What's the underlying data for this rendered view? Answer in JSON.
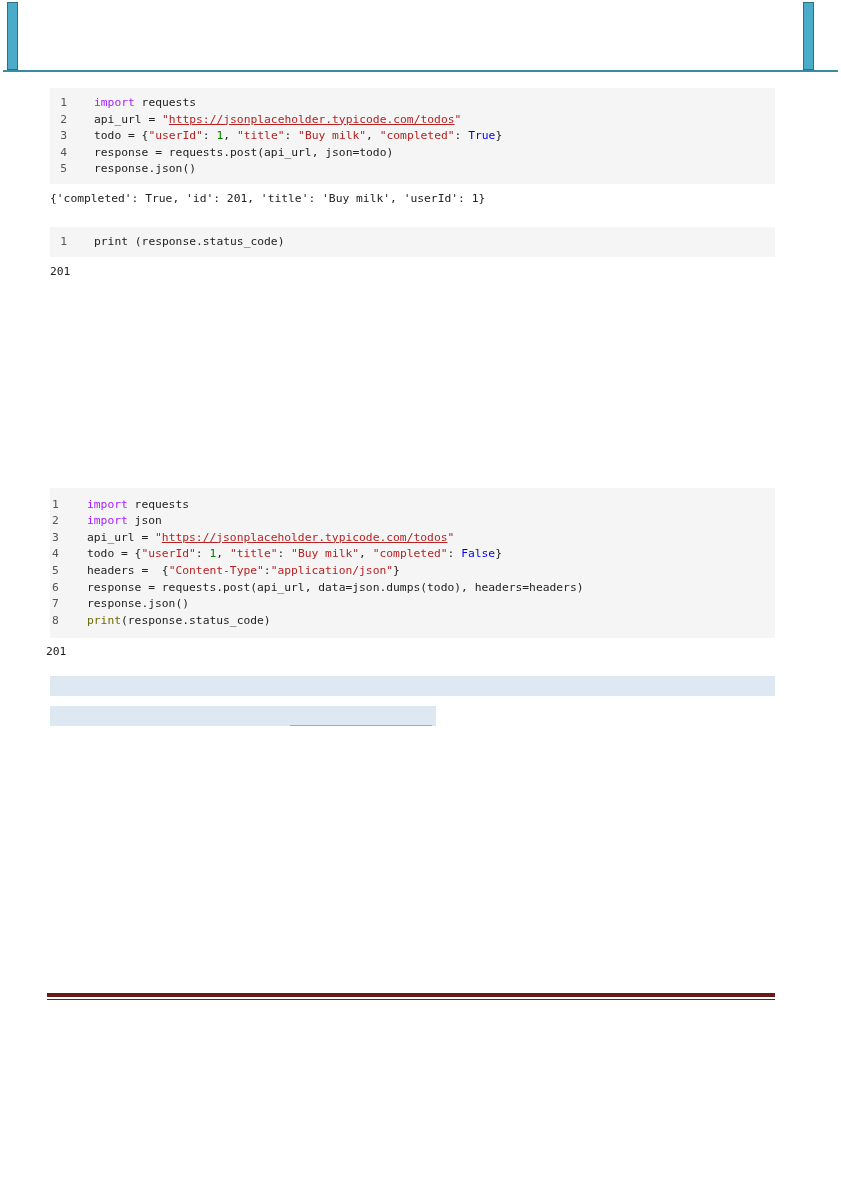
{
  "cells": [
    {
      "kind": "code",
      "lines": [
        {
          "number": "1",
          "tokens": [
            {
              "kind": "keyword",
              "text": "import"
            },
            {
              "kind": "plain",
              "text": " requests"
            }
          ]
        },
        {
          "number": "2",
          "tokens": [
            {
              "kind": "plain",
              "text": "api_url = "
            },
            {
              "kind": "string",
              "text": "\""
            },
            {
              "kind": "link",
              "text": "https://jsonplaceholder.typicode.com/todos"
            },
            {
              "kind": "string",
              "text": "\""
            }
          ]
        },
        {
          "number": "3",
          "tokens": [
            {
              "kind": "plain",
              "text": "todo = {"
            },
            {
              "kind": "string",
              "text": "\"userId\""
            },
            {
              "kind": "plain",
              "text": ": "
            },
            {
              "kind": "number",
              "text": "1"
            },
            {
              "kind": "plain",
              "text": ", "
            },
            {
              "kind": "string",
              "text": "\"title\""
            },
            {
              "kind": "plain",
              "text": ": "
            },
            {
              "kind": "string",
              "text": "\"Buy milk\""
            },
            {
              "kind": "plain",
              "text": ", "
            },
            {
              "kind": "string",
              "text": "\"completed\""
            },
            {
              "kind": "plain",
              "text": ": "
            },
            {
              "kind": "constant",
              "text": "True"
            },
            {
              "kind": "plain",
              "text": "}"
            }
          ]
        },
        {
          "number": "4",
          "tokens": [
            {
              "kind": "plain",
              "text": "response = requests.post(api_url, json=todo)"
            }
          ]
        },
        {
          "number": "5",
          "tokens": [
            {
              "kind": "plain",
              "text": "response.json()"
            }
          ]
        }
      ]
    },
    {
      "kind": "output",
      "text": "{'completed': True, 'id': 201, 'title': 'Buy milk', 'userId': 1}"
    },
    {
      "kind": "code",
      "lines": [
        {
          "number": "1",
          "tokens": [
            {
              "kind": "plain",
              "text": "print (response.status_code)"
            }
          ]
        }
      ]
    },
    {
      "kind": "output",
      "text": "201"
    },
    {
      "kind": "gap"
    },
    {
      "kind": "code_wide",
      "lines": [
        {
          "number": "1",
          "tokens": [
            {
              "kind": "keyword",
              "text": "import"
            },
            {
              "kind": "plain",
              "text": " requests"
            }
          ]
        },
        {
          "number": "2",
          "tokens": [
            {
              "kind": "keyword",
              "text": "import"
            },
            {
              "kind": "plain",
              "text": " json"
            }
          ]
        },
        {
          "number": "3",
          "tokens": [
            {
              "kind": "plain",
              "text": "api_url = "
            },
            {
              "kind": "string",
              "text": "\""
            },
            {
              "kind": "link",
              "text": "https://jsonplaceholder.typicode.com/todos"
            },
            {
              "kind": "string",
              "text": "\""
            }
          ]
        },
        {
          "number": "4",
          "tokens": [
            {
              "kind": "plain",
              "text": "todo = {"
            },
            {
              "kind": "string",
              "text": "\"userId\""
            },
            {
              "kind": "plain",
              "text": ": "
            },
            {
              "kind": "number",
              "text": "1"
            },
            {
              "kind": "plain",
              "text": ", "
            },
            {
              "kind": "string",
              "text": "\"title\""
            },
            {
              "kind": "plain",
              "text": ": "
            },
            {
              "kind": "string",
              "text": "\"Buy milk\""
            },
            {
              "kind": "plain",
              "text": ", "
            },
            {
              "kind": "string",
              "text": "\"completed\""
            },
            {
              "kind": "plain",
              "text": ": "
            },
            {
              "kind": "constant",
              "text": "False"
            },
            {
              "kind": "plain",
              "text": "}"
            }
          ]
        },
        {
          "number": "5",
          "tokens": [
            {
              "kind": "plain",
              "text": "headers =  {"
            },
            {
              "kind": "string",
              "text": "\"Content-Type\""
            },
            {
              "kind": "plain",
              "text": ":"
            },
            {
              "kind": "string",
              "text": "\"application/json\""
            },
            {
              "kind": "plain",
              "text": "}"
            }
          ]
        },
        {
          "number": "6",
          "tokens": [
            {
              "kind": "plain",
              "text": "response = requests.post(api_url, data=json.dumps(todo), headers=headers)"
            }
          ]
        },
        {
          "number": "7",
          "tokens": [
            {
              "kind": "plain",
              "text": "response.json()"
            }
          ]
        },
        {
          "number": "8",
          "tokens": [
            {
              "kind": "builtin",
              "text": "print"
            },
            {
              "kind": "plain",
              "text": "(response.status_code)"
            }
          ]
        }
      ]
    },
    {
      "kind": "output_clipped",
      "text": "201"
    },
    {
      "kind": "highlight"
    },
    {
      "kind": "highlight_short"
    }
  ]
}
